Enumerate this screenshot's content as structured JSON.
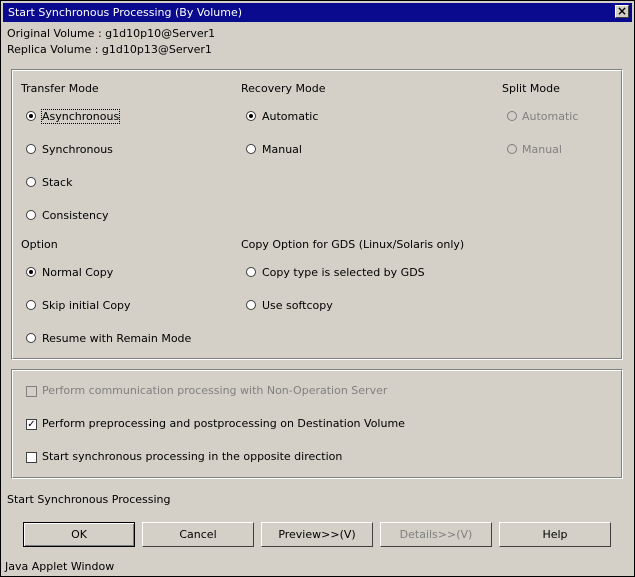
{
  "window": {
    "title": "Start Synchronous Processing (By Volume)",
    "close": "×"
  },
  "info": {
    "original": "Original Volume : g1d10p10@Server1",
    "replica": "Replica Volume : g1d10p13@Server1"
  },
  "transfer_mode": {
    "heading": "Transfer Mode",
    "options": [
      "Asynchronous",
      "Synchronous",
      "Stack",
      "Consistency"
    ],
    "selected": "Asynchronous"
  },
  "recovery_mode": {
    "heading": "Recovery Mode",
    "options": [
      "Automatic",
      "Manual"
    ],
    "selected": "Automatic"
  },
  "split_mode": {
    "heading": "Split Mode",
    "options": [
      "Automatic",
      "Manual"
    ],
    "enabled": false
  },
  "option": {
    "heading": "Option",
    "options": [
      "Normal Copy",
      "Skip initial Copy",
      "Resume with Remain Mode"
    ],
    "selected": "Normal Copy"
  },
  "copy_option": {
    "heading": "Copy Option for GDS (Linux/Solaris only)",
    "options": [
      "Copy type is selected by GDS",
      "Use softcopy"
    ]
  },
  "checks": [
    {
      "label": "Perform communication processing with Non-Operation Server",
      "checked": false,
      "enabled": false
    },
    {
      "label": "Perform preprocessing and postprocessing on Destination Volume",
      "checked": true,
      "enabled": true
    },
    {
      "label": "Start synchronous processing in the opposite direction",
      "checked": false,
      "enabled": true
    }
  ],
  "status": "Start Synchronous Processing",
  "buttons": {
    "ok": "OK",
    "cancel": "Cancel",
    "preview": "Preview>>(V)",
    "details": "Details>>(V)",
    "help": "Help"
  },
  "footer": "Java Applet Window"
}
